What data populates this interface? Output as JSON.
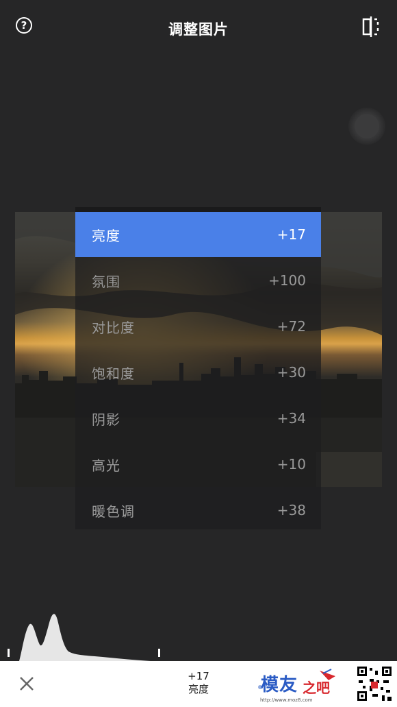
{
  "header": {
    "title": "调整图片",
    "help_icon_label": "?"
  },
  "adjustments": {
    "items": [
      {
        "label": "亮度",
        "value": "+17",
        "active": true
      },
      {
        "label": "氛围",
        "value": "+100",
        "active": false
      },
      {
        "label": "对比度",
        "value": "+72",
        "active": false
      },
      {
        "label": "饱和度",
        "value": "+30",
        "active": false
      },
      {
        "label": "阴影",
        "value": "+34",
        "active": false
      },
      {
        "label": "高光",
        "value": "+10",
        "active": false
      },
      {
        "label": "暖色调",
        "value": "+38",
        "active": false
      }
    ]
  },
  "footer": {
    "current_value": "+17",
    "current_name": "亮度"
  },
  "watermark": {
    "brand": "模友",
    "brand2": "之吧",
    "url": "http://www.moz8.com"
  },
  "colors": {
    "accent": "#4a80e8",
    "background": "#262627",
    "bottom_bar": "#ffffff"
  }
}
